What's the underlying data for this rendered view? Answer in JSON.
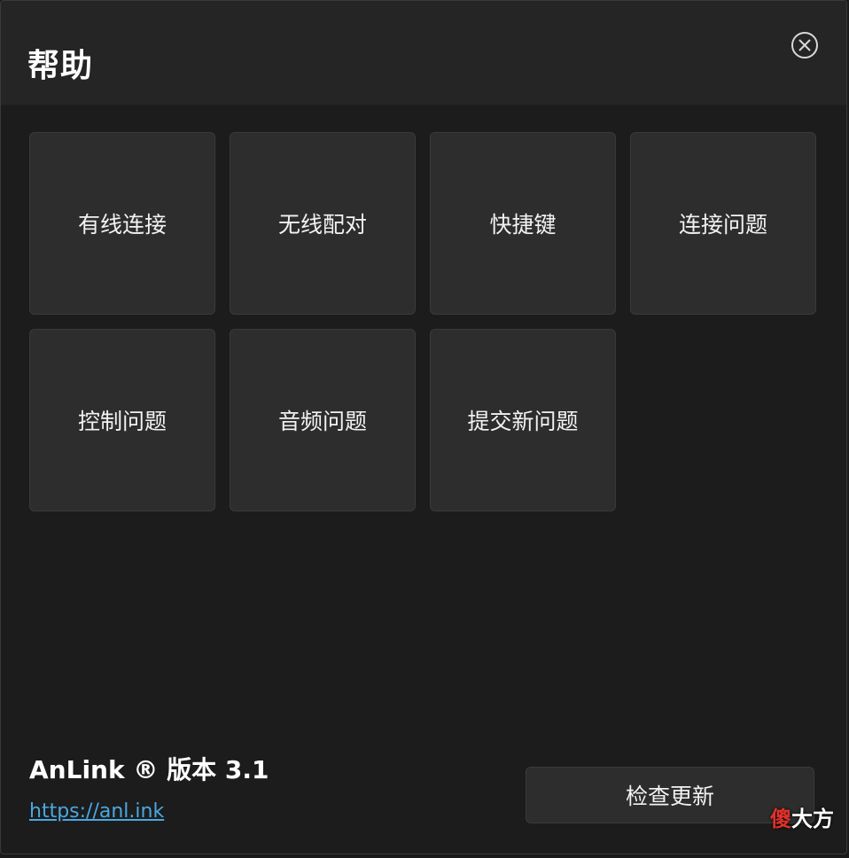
{
  "dialog": {
    "title": "帮助"
  },
  "tiles": [
    {
      "label": "有线连接"
    },
    {
      "label": "无线配对"
    },
    {
      "label": "快捷键"
    },
    {
      "label": "连接问题"
    },
    {
      "label": "控制问题"
    },
    {
      "label": "音频问题"
    },
    {
      "label": "提交新问题"
    }
  ],
  "footer": {
    "version_text": "AnLink ® 版本 3.1",
    "website_link": "https://anl.ink",
    "update_button_label": "检查更新"
  },
  "watermark": {
    "accent_char": "傻",
    "rest": "大方"
  },
  "icons": {
    "close": "close-circle-icon"
  },
  "colors": {
    "background": "#1c1c1c",
    "titlebar": "#252525",
    "tile": "#2d2d2d",
    "link": "#4aa8e0"
  }
}
